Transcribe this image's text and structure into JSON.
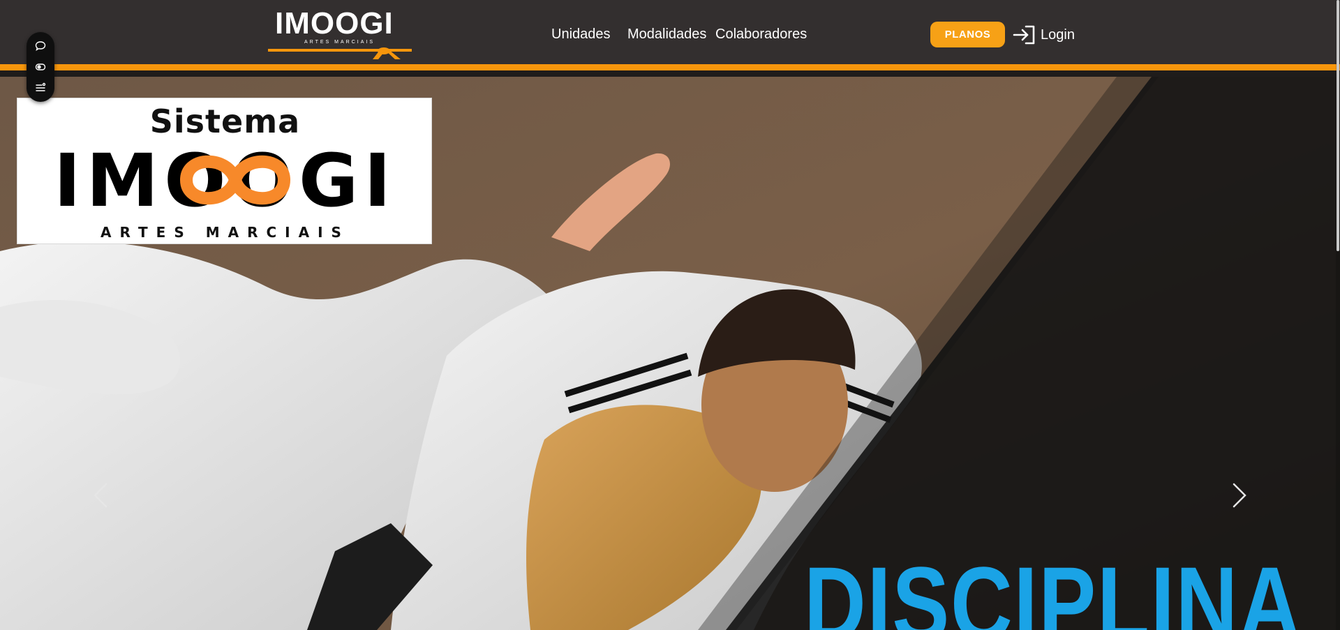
{
  "header": {
    "brand": {
      "name": "IMOOGI",
      "tagline": "ARTES MARCIAIS"
    },
    "nav": [
      {
        "label": "Unidades"
      },
      {
        "label": "Modalidades"
      },
      {
        "label": "Colaboradores"
      }
    ],
    "planos_label": "PLANOS",
    "login_label": "Login"
  },
  "toolbar": {
    "icons": [
      "chat-icon",
      "eye-icon",
      "menu-lines-icon"
    ]
  },
  "hero": {
    "logo_card": {
      "top_text": "Sistema",
      "brand_word": "IMOOGI",
      "bottom_text": "ARTES MARCIAIS"
    },
    "headline": "DISCIPLINA",
    "prev_icon": "chevron-left-icon",
    "next_icon": "chevron-right-icon"
  },
  "colors": {
    "header_bg": "#332f2f",
    "accent_orange": "#f7960c",
    "planos_bg": "#f7a116",
    "headline_blue": "#1aa3e6"
  }
}
